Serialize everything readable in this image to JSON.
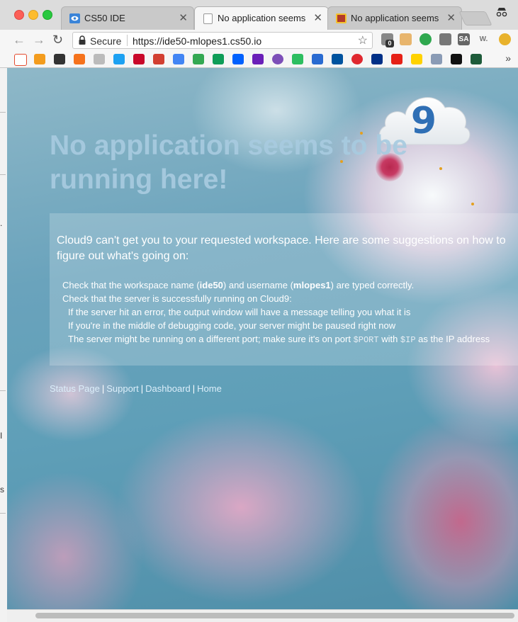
{
  "browser": {
    "tabs": [
      {
        "title": "CS50 IDE",
        "icon": "cs50-ide-icon",
        "active": false
      },
      {
        "title": "No application seems to",
        "icon": "page-icon",
        "active": true
      },
      {
        "title": "No application seems to",
        "icon": "favicon-icon",
        "active": false
      }
    ],
    "security_label": "Secure",
    "url": "https://ide50-mlopes1.cs50.io",
    "extension_badge": "0",
    "extension_labels": {
      "sa": "SA",
      "w": "W."
    }
  },
  "page": {
    "headline": "No application seems to be running here!",
    "intro": "Cloud9 can't get you to your requested workspace. Here are some suggestions on how to figure out what's going on:",
    "tips": {
      "line1_a": "Check that the workspace name (",
      "line1_ws": "ide50",
      "line1_b": ") and username (",
      "line1_user": "mlopes1",
      "line1_c": ") are typed correctly.",
      "line2": "Check that the server is successfully running on Cloud9:",
      "line3": "If the server hit an error, the output window will have a message telling you what it is",
      "line4": "If you're in the middle of debugging code, your server might be paused right now",
      "line5_a": "The server might be running on a different port; make sure it's on port ",
      "line5_port": "$PORT",
      "line5_b": " with ",
      "line5_ip": "$IP",
      "line5_c": " as the IP address"
    },
    "footer": {
      "status": "Status Page",
      "support": "Support",
      "dashboard": "Dashboard",
      "home": "Home",
      "separator": "|"
    },
    "logo_text": "9"
  },
  "colors": {
    "accent_blue": "#2f6fb5",
    "headline": "#a8cbe0",
    "link": "#dbeefa"
  }
}
